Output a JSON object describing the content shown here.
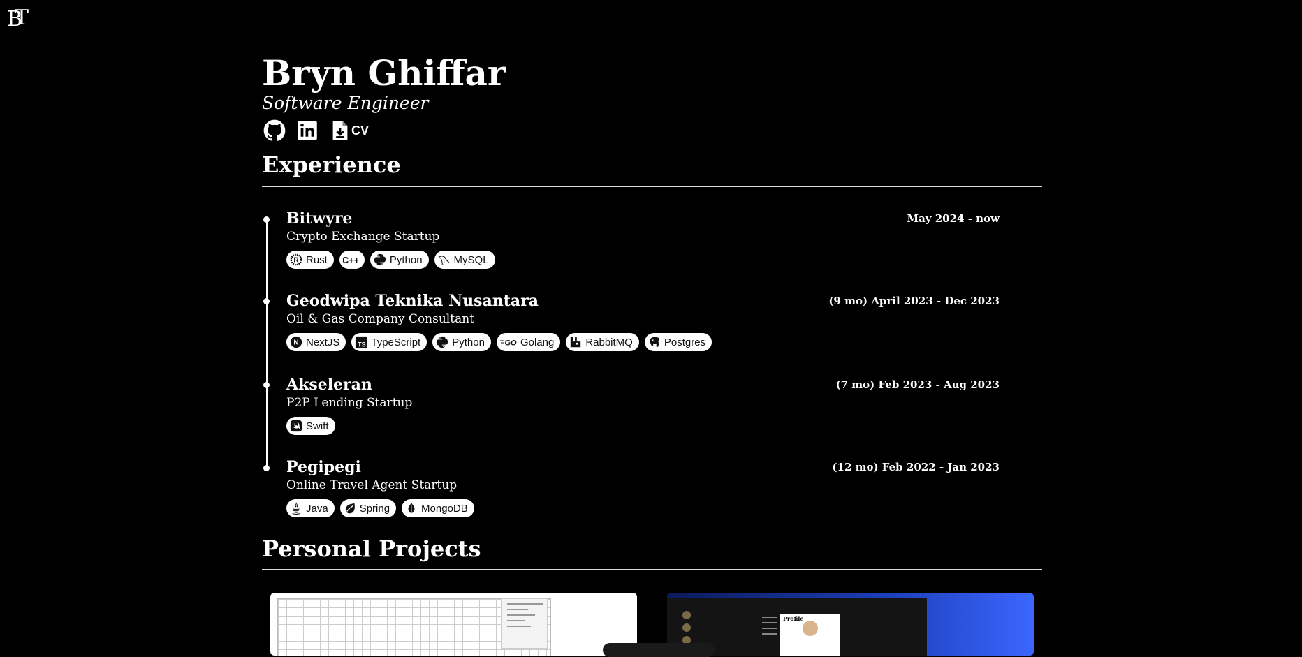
{
  "logo": {
    "text_b": "B",
    "text_t": "T",
    "icon": "bt-monogram-logo"
  },
  "profile": {
    "name": "Bryn Ghiffar",
    "role": "Software Engineer",
    "links": [
      {
        "icon": "github-icon"
      },
      {
        "icon": "linkedin-icon"
      },
      {
        "icon": "file-download-icon",
        "label": "CV"
      }
    ]
  },
  "experience": {
    "title": "Experience",
    "jobs": [
      {
        "company": "Bitwyre",
        "description": "Crypto Exchange Startup",
        "date": "May 2024 - now",
        "tags": [
          {
            "label": "Rust",
            "icon": "rust-icon"
          },
          {
            "label": "",
            "icon": "cpp-icon"
          },
          {
            "label": "Python",
            "icon": "python-icon"
          },
          {
            "label": "MySQL",
            "icon": "mysql-icon"
          }
        ]
      },
      {
        "company": "Geodwipa Teknika Nusantara",
        "description": "Oil & Gas Company Consultant",
        "date": "(9 mo) April 2023 - Dec 2023",
        "tags": [
          {
            "label": "NextJS",
            "icon": "nextjs-icon"
          },
          {
            "label": "TypeScript",
            "icon": "typescript-icon"
          },
          {
            "label": "Python",
            "icon": "python-icon"
          },
          {
            "label": "Golang",
            "icon": "golang-icon"
          },
          {
            "label": "RabbitMQ",
            "icon": "rabbitmq-icon"
          },
          {
            "label": "Postgres",
            "icon": "postgres-icon"
          }
        ]
      },
      {
        "company": "Akseleran",
        "description": "P2P Lending Startup",
        "date": "(7 mo) Feb 2023 - Aug 2023",
        "tags": [
          {
            "label": "Swift",
            "icon": "swift-icon"
          }
        ]
      },
      {
        "company": "Pegipegi",
        "description": "Online Travel Agent Startup",
        "date": "(12 mo) Feb 2022 - Jan 2023",
        "tags": [
          {
            "label": "Java",
            "icon": "java-icon"
          },
          {
            "label": "Spring",
            "icon": "spring-icon"
          },
          {
            "label": "MongoDB",
            "icon": "mongodb-icon"
          }
        ]
      }
    ]
  },
  "projects": {
    "title": "Personal Projects",
    "cards": [
      {
        "name": "project-card-grid-editor",
        "background": "#ffffff"
      },
      {
        "name": "project-card-profile-app",
        "background": "#3b66ff",
        "card_heading": "Profile"
      }
    ]
  },
  "colors": {
    "background": "#000000",
    "text": "#ffffff",
    "tag_bg": "#ffffff",
    "tag_text": "#111111"
  }
}
